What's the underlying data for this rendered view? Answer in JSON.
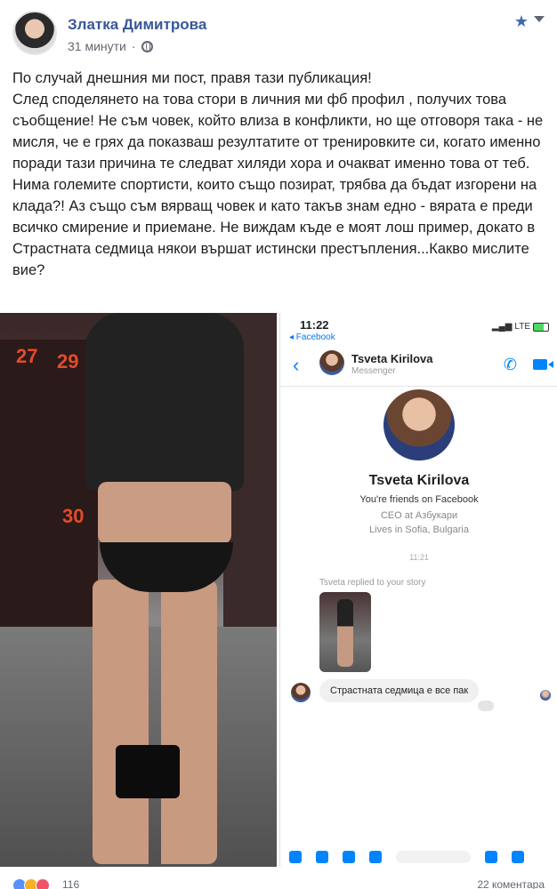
{
  "header": {
    "author": "Златка Димитрова",
    "time": "31 минути"
  },
  "post": {
    "paragraphs": [
      "По случай днешния ми пост, правя тази публикация!",
      "След споделянето на това стори в личния ми фб профил , получих това съобщение! Не съм човек, който влиза в конфликти, но ще отговоря така - не мисля, че е грях да показваш резултатите от тренировките си, когато именно поради тази причина те следват хиляди хора и очакват именно това от теб.",
      "Нима големите спортисти, които също позират, трябва да бъдат изгорени на клада?! Аз също съм вярващ човек и като такъв знам едно - вярата е преди всичко смирение и приемане. Не виждам къде е моят лош пример, докато в Страстната седмица някои вършат истински престъпления...Какво мислите вие?"
    ]
  },
  "photo": {
    "locker_numbers": [
      "27",
      "29",
      "30"
    ]
  },
  "messenger": {
    "time": "11:22",
    "back_app": "◂ Facebook",
    "network": "LTE",
    "contact_name": "Tsveta Kirilova",
    "contact_sub": "Messenger",
    "profile_name": "Tsveta Kirilova",
    "friends_line": "You're friends on Facebook",
    "work_line": "CEO at Азбукари",
    "lives_line": "Lives in Sofia, Bulgaria",
    "timestamp": "11:21",
    "replied_label": "Tsveta replied to your story",
    "message": "Страстната седмица е все пак"
  },
  "footer": {
    "reaction_count": "116",
    "comments": "22 коментара"
  },
  "colors": {
    "author_link": "#385898",
    "messenger_blue": "#0084ff",
    "like": "#5890ff",
    "haha": "#f7b125",
    "love": "#f25268"
  }
}
